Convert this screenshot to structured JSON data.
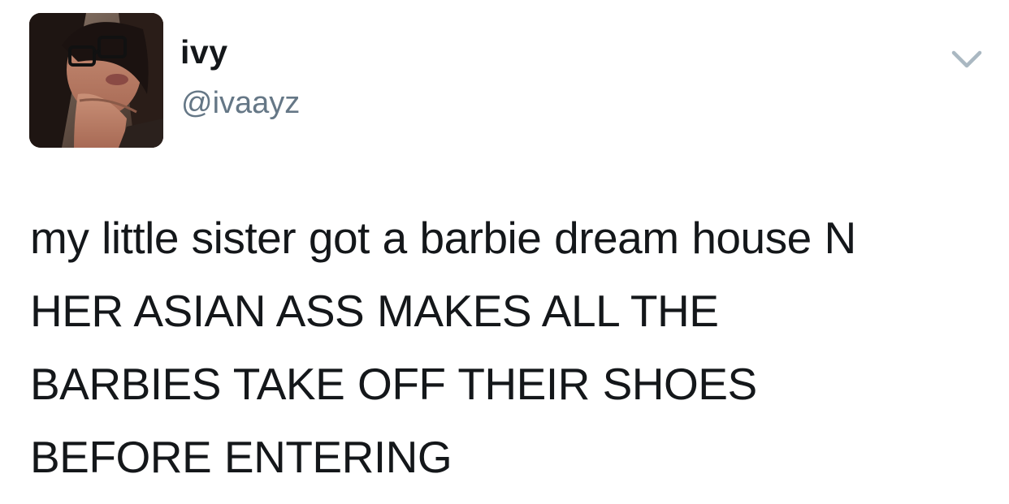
{
  "tweet": {
    "author": {
      "display_name": "ivy",
      "handle": "@ivaayz",
      "avatar_icon": "profile-photo"
    },
    "menu_icon": "chevron-down-icon",
    "text_lines": [
      "my little sister got a barbie dream house N",
      "HER ASIAN ASS MAKES ALL THE",
      "BARBIES TAKE OFF THEIR SHOES",
      "BEFORE ENTERING"
    ],
    "colors": {
      "text": "#14171a",
      "handle": "#657786",
      "chevron": "#aab8c2",
      "background": "#ffffff"
    }
  }
}
